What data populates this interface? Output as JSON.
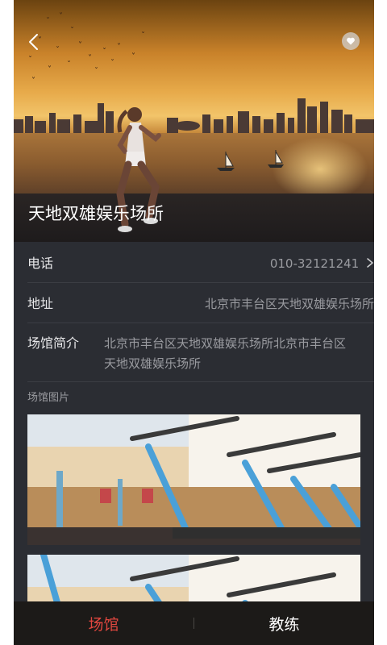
{
  "venue": {
    "name": "天地双雄娱乐场所"
  },
  "icons": {
    "back": "chevron-left-icon",
    "favorite": "heart-icon",
    "phone_arrow": "chevron-right-icon"
  },
  "info": {
    "phone_label": "电话",
    "phone_value": "010-32121241",
    "address_label": "地址",
    "address_value": "北京市丰台区天地双雄娱乐场所",
    "intro_label": "场馆简介",
    "intro_value": "北京市丰台区天地双雄娱乐场所北京市丰台区天地双雄娱乐场所"
  },
  "gallery": {
    "label": "场馆图片"
  },
  "tabs": [
    {
      "label": "场馆",
      "active": true
    },
    {
      "label": "教练",
      "active": false
    }
  ],
  "colors": {
    "accent": "#e0473f",
    "background": "#2b2d33",
    "tabbar": "#1c1a18"
  }
}
